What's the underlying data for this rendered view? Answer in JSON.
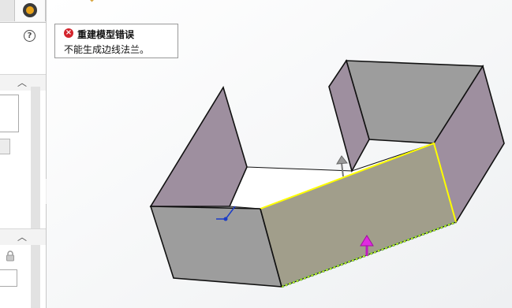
{
  "error_tooltip": {
    "title": "重建模型错误",
    "message": "不能生成边线法兰。",
    "icon": "error-icon"
  },
  "left_panel": {
    "help_icon_text": "?",
    "tabs": [
      {
        "icon": "property-tab-icon"
      },
      {
        "icon": "appearance-tab-icon"
      }
    ]
  },
  "model": {
    "face_color": "#a19e8b",
    "wall_color": "#9d9d9d",
    "inner_color": "#9e8f9f",
    "edge_highlight": "#ffff00"
  }
}
